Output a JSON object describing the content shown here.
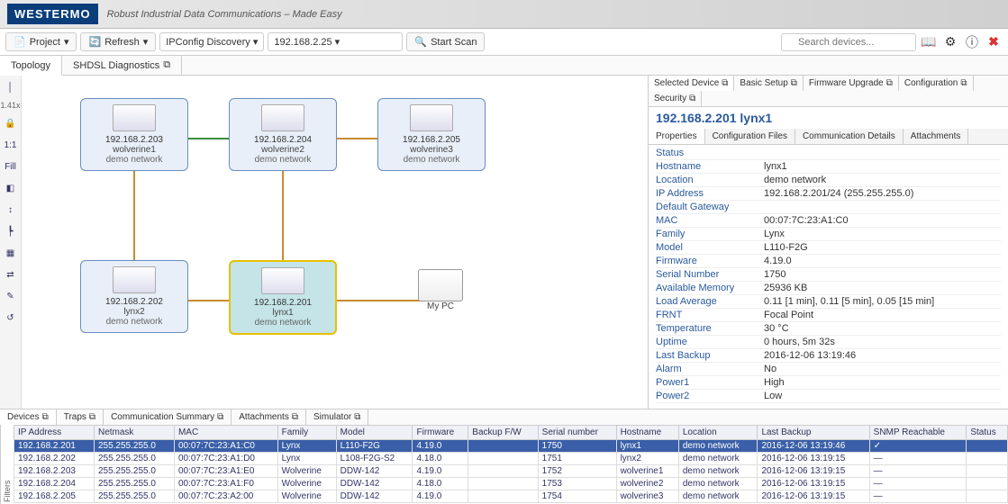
{
  "brand": {
    "logo": "WESTERMO",
    "tagline": "Robust Industrial Data Communications – Made Easy"
  },
  "toolbar": {
    "project": "Project",
    "refresh": "Refresh",
    "discovery": "IPConfig Discovery",
    "ip": "192.168.2.25",
    "scan": "Start Scan",
    "search_placeholder": "Search devices..."
  },
  "main_tabs": {
    "topology": "Topology",
    "shdsl": "SHDSL Diagnostics"
  },
  "left_tools": {
    "zoom": "1.41x",
    "lock": "",
    "ratio": "1:1",
    "fill": "Fill"
  },
  "nodes": {
    "n1": {
      "ip": "192.168.2.203",
      "name": "wolverine1",
      "net": "demo network"
    },
    "n2": {
      "ip": "192.168.2.204",
      "name": "wolverine2",
      "net": "demo network"
    },
    "n3": {
      "ip": "192.168.2.205",
      "name": "wolverine3",
      "net": "demo network"
    },
    "n4": {
      "ip": "192.168.2.202",
      "name": "lynx2",
      "net": "demo network"
    },
    "n5": {
      "ip": "192.168.2.201",
      "name": "lynx1",
      "net": "demo network"
    },
    "pc": {
      "label": "My PC"
    }
  },
  "right": {
    "tabs": {
      "selected": "Selected Device",
      "basic": "Basic Setup",
      "fw": "Firmware Upgrade",
      "conf": "Configuration",
      "sec": "Security"
    },
    "title": "192.168.2.201  lynx1",
    "subtabs": {
      "props": "Properties",
      "conf": "Configuration Files",
      "comm": "Communication Details",
      "att": "Attachments"
    },
    "props": [
      {
        "k": "Status",
        "v": ""
      },
      {
        "k": "Hostname",
        "v": "lynx1"
      },
      {
        "k": "Location",
        "v": "demo network"
      },
      {
        "k": "IP Address",
        "v": "192.168.2.201/24 (255.255.255.0)"
      },
      {
        "k": "Default Gateway",
        "v": ""
      },
      {
        "k": "MAC",
        "v": "00:07:7C:23:A1:C0"
      },
      {
        "k": "Family",
        "v": "Lynx"
      },
      {
        "k": "Model",
        "v": "L110-F2G"
      },
      {
        "k": "Firmware",
        "v": "4.19.0"
      },
      {
        "k": "Serial Number",
        "v": "1750"
      },
      {
        "k": "Available Memory",
        "v": "25936 KB"
      },
      {
        "k": "Load Average",
        "v": "0.11 [1 min],  0.11 [5 min],  0.05 [15 min]"
      },
      {
        "k": "FRNT",
        "v": "Focal Point"
      },
      {
        "k": "Temperature",
        "v": "30 °C"
      },
      {
        "k": "Uptime",
        "v": "0 hours, 5m 32s"
      },
      {
        "k": "Last Backup",
        "v": "2016-12-06 13:19:46"
      },
      {
        "k": "Alarm",
        "v": "No"
      },
      {
        "k": "Power1",
        "v": "High"
      },
      {
        "k": "Power2",
        "v": "Low"
      }
    ]
  },
  "bottom": {
    "tabs": {
      "devices": "Devices",
      "traps": "Traps",
      "comm": "Communication Summary",
      "att": "Attachments",
      "sim": "Simulator"
    },
    "columns": [
      "IP Address",
      "Netmask",
      "MAC",
      "Family",
      "Model",
      "Firmware",
      "Backup F/W",
      "Serial number",
      "Hostname",
      "Location",
      "Last Backup",
      "SNMP Reachable",
      "Status"
    ],
    "rows": [
      {
        "ip": "192.168.2.201",
        "mask": "255.255.255.0",
        "mac": "00:07:7C:23:A1:C0",
        "fam": "Lynx",
        "model": "L110-F2G",
        "fw": "4.19.0",
        "bfw": "",
        "sn": "1750",
        "host": "lynx1",
        "loc": "demo network",
        "lb": "2016-12-06 13:19:46",
        "snmp": "✓",
        "st": ""
      },
      {
        "ip": "192.168.2.202",
        "mask": "255.255.255.0",
        "mac": "00:07:7C:23:A1:D0",
        "fam": "Lynx",
        "model": "L108-F2G-S2",
        "fw": "4.18.0",
        "bfw": "",
        "sn": "1751",
        "host": "lynx2",
        "loc": "demo network",
        "lb": "2016-12-06 13:19:15",
        "snmp": "—",
        "st": ""
      },
      {
        "ip": "192.168.2.203",
        "mask": "255.255.255.0",
        "mac": "00:07:7C:23:A1:E0",
        "fam": "Wolverine",
        "model": "DDW-142",
        "fw": "4.19.0",
        "bfw": "",
        "sn": "1752",
        "host": "wolverine1",
        "loc": "demo network",
        "lb": "2016-12-06 13:19:15",
        "snmp": "—",
        "st": ""
      },
      {
        "ip": "192.168.2.204",
        "mask": "255.255.255.0",
        "mac": "00:07:7C:23:A1:F0",
        "fam": "Wolverine",
        "model": "DDW-142",
        "fw": "4.18.0",
        "bfw": "",
        "sn": "1753",
        "host": "wolverine2",
        "loc": "demo network",
        "lb": "2016-12-06 13:19:15",
        "snmp": "—",
        "st": ""
      },
      {
        "ip": "192.168.2.205",
        "mask": "255.255.255.0",
        "mac": "00:07:7C:23:A2:00",
        "fam": "Wolverine",
        "model": "DDW-142",
        "fw": "4.19.0",
        "bfw": "",
        "sn": "1754",
        "host": "wolverine3",
        "loc": "demo network",
        "lb": "2016-12-06 13:19:15",
        "snmp": "—",
        "st": ""
      }
    ]
  }
}
